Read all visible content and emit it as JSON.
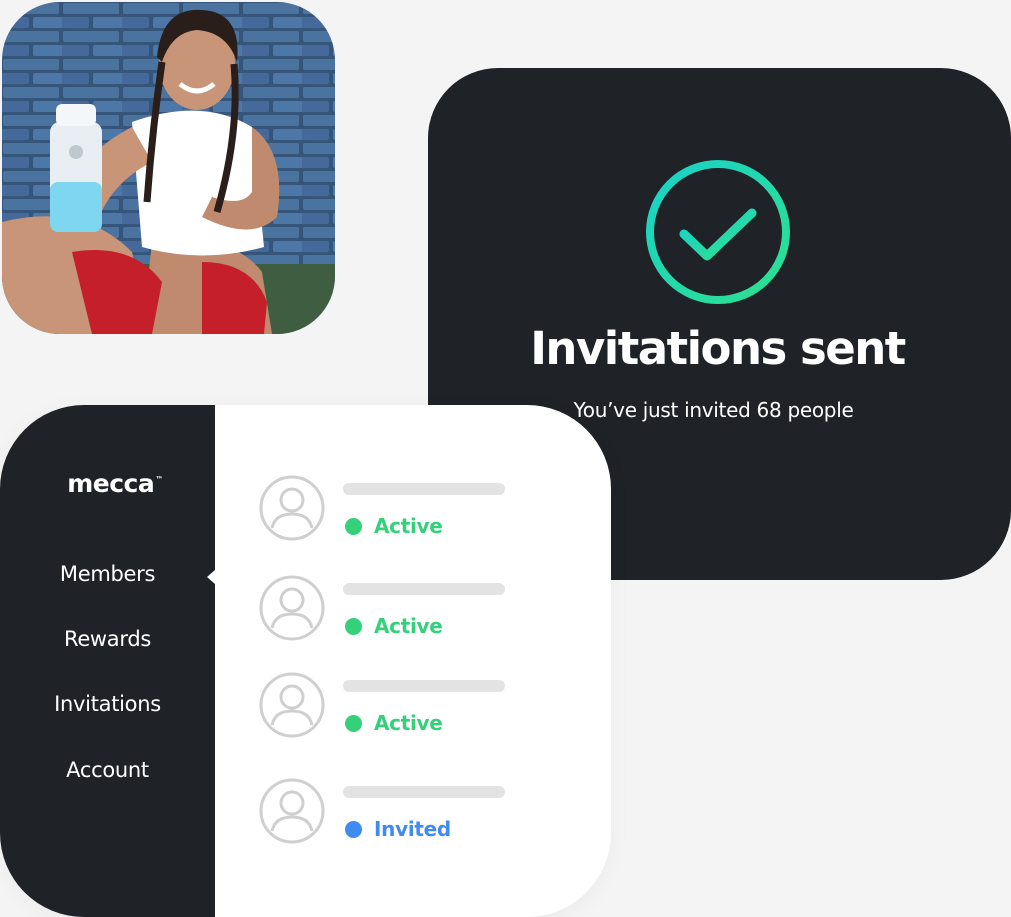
{
  "colors": {
    "page_bg": "#f4f4f4",
    "dark": "#1f2328",
    "active": "#34d17a",
    "invited": "#3f8cf0",
    "check_gradient_start": "#19d2c8",
    "check_gradient_end": "#2ee08f"
  },
  "photo": {
    "icon": "person-holding-shaker-photo"
  },
  "success": {
    "icon": "check-circle-icon",
    "title": "Invitations sent",
    "subtitle": "You’ve just invited 68 people"
  },
  "app": {
    "logo": "mecca",
    "logo_mark": "™",
    "nav": [
      {
        "label": "Members",
        "active": true
      },
      {
        "label": "Rewards",
        "active": false
      },
      {
        "label": "Invitations",
        "active": false
      },
      {
        "label": "Account",
        "active": false
      }
    ],
    "members": [
      {
        "status": "Active",
        "status_type": "active"
      },
      {
        "status": "Active",
        "status_type": "active"
      },
      {
        "status": "Active",
        "status_type": "active"
      },
      {
        "status": "Invited",
        "status_type": "invited"
      }
    ]
  }
}
